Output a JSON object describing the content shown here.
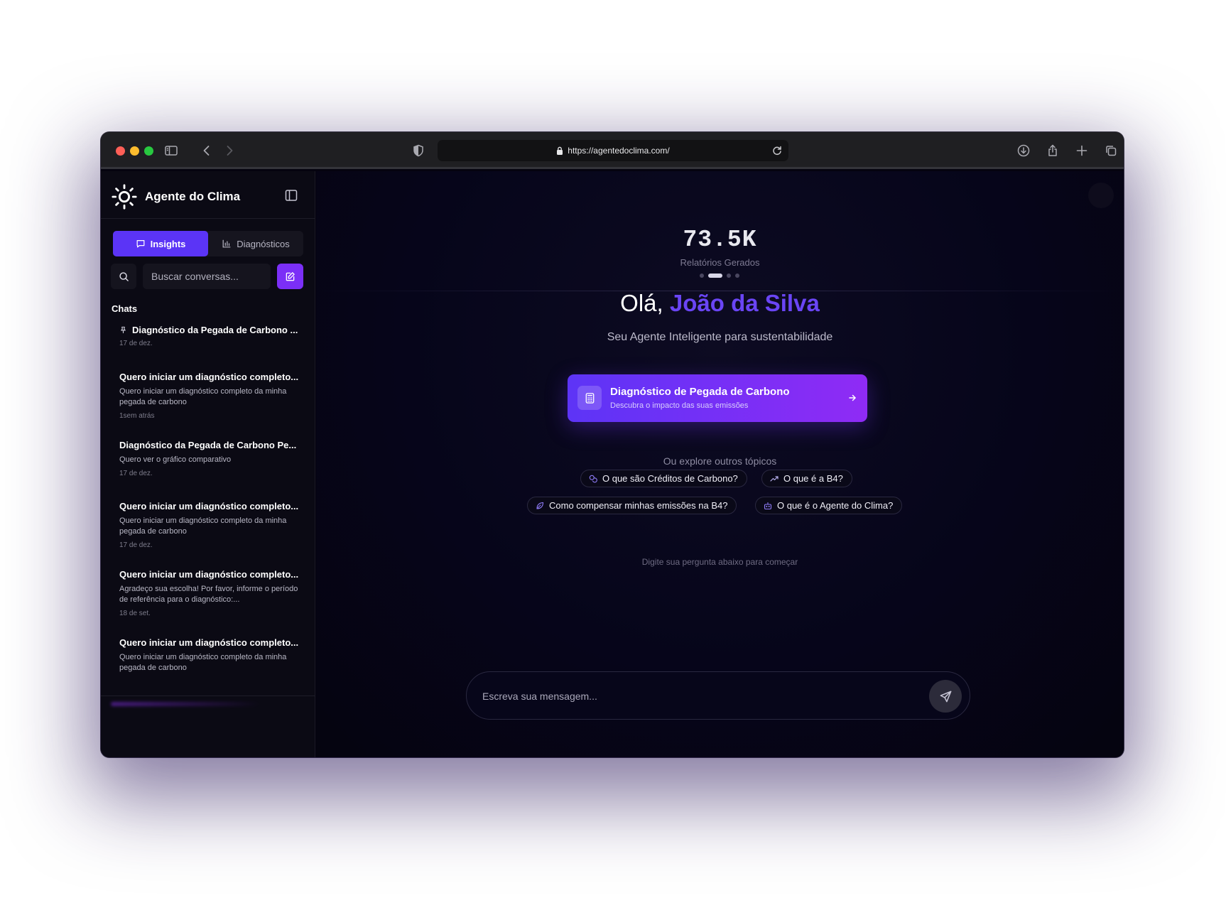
{
  "browser": {
    "url": "https://agentedoclima.com/"
  },
  "sidebar": {
    "brand_name": "Agente do Clima",
    "tabs": [
      {
        "label": "Insights",
        "icon": "message-square-icon",
        "active": true
      },
      {
        "label": "Diagnósticos",
        "icon": "bar-chart-icon",
        "active": false
      }
    ],
    "search_placeholder": "Buscar conversas...",
    "section_label": "Chats",
    "chats": [
      {
        "title": "Diagnóstico da Pegada de Carbono ...",
        "preview": "",
        "date": "17 de dez.",
        "pinned": true
      },
      {
        "title": "Quero iniciar um diagnóstico completo...",
        "preview": "Quero iniciar um diagnóstico completo da minha pegada de carbono",
        "date": "1sem atrás"
      },
      {
        "title": "Diagnóstico da Pegada de Carbono Pe...",
        "preview": "Quero ver o gráfico comparativo",
        "date": "17 de dez."
      },
      {
        "title": "Quero iniciar um diagnóstico completo...",
        "preview": "Quero iniciar um diagnóstico completo da minha pegada de carbono",
        "date": "17 de dez."
      },
      {
        "title": "Quero iniciar um diagnóstico completo...",
        "preview": "Agradeço sua escolha! Por favor, informe o período de referência para o diagnóstico:...",
        "date": "18 de set."
      },
      {
        "title": "Quero iniciar um diagnóstico completo...",
        "preview": "Quero iniciar um diagnóstico completo da minha pegada de carbono",
        "date": ""
      }
    ]
  },
  "main": {
    "stat": {
      "value": "73.5K",
      "label": "Relatórios Gerados"
    },
    "carousel": {
      "count": 4,
      "active_index": 1
    },
    "greeting_prefix": "Olá,",
    "greeting_name": "João da Silva",
    "subtitle": "Seu Agente Inteligente para sustentabilidade",
    "cta": {
      "title": "Diagnóstico de Pegada de Carbono",
      "subtitle": "Descubra o impacto das suas emissões",
      "icon": "calculator-icon"
    },
    "explore_label": "Ou explore outros tópicos",
    "topics": [
      {
        "label": "O que são Créditos de Carbono?",
        "icon": "coins-icon"
      },
      {
        "label": "O que é a B4?",
        "icon": "trending-up-icon"
      },
      {
        "label": "Como compensar minhas emissões na B4?",
        "icon": "leaf-icon"
      },
      {
        "label": "O que é o Agente do Clima?",
        "icon": "bot-icon"
      }
    ],
    "hint": "Digite sua pergunta abaixo para começar",
    "composer_placeholder": "Escreva sua mensagem..."
  },
  "colors": {
    "accent": "#5b34f6",
    "accent_gradient_end": "#8f2bf5",
    "greeting_name": "#6a45f5",
    "background": "#05040f"
  }
}
